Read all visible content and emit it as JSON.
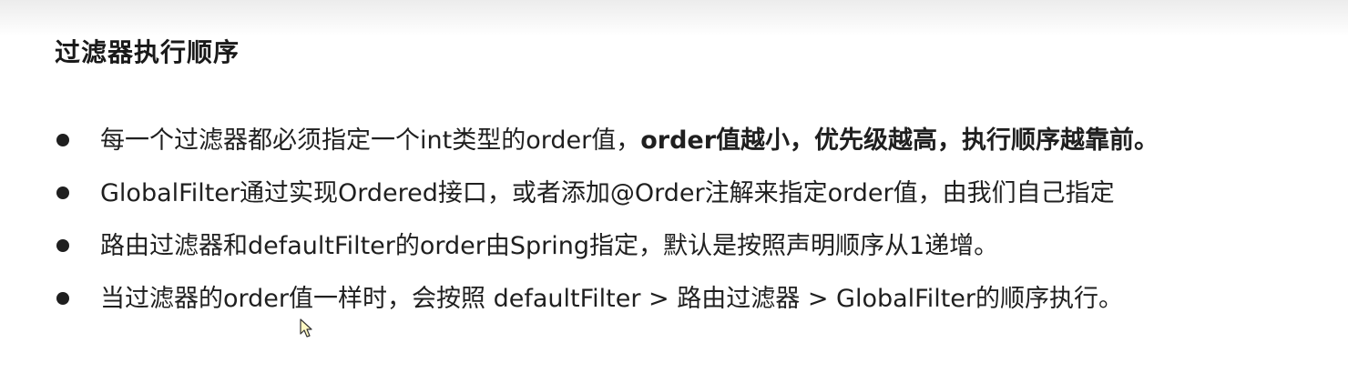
{
  "slide": {
    "title": "过滤器执行顺序",
    "bullets": [
      {
        "text": "每一个过滤器都必须指定一个int类型的order值，",
        "emphasis": "order值越小，优先级越高，执行顺序越靠前。"
      },
      {
        "text": "GlobalFilter通过实现Ordered接口，或者添加@Order注解来指定order值，由我们自己指定"
      },
      {
        "text": "路由过滤器和defaultFilter的order由Spring指定，默认是按照声明顺序从1递增。"
      },
      {
        "text": "当过滤器的order值一样时，会按照 defaultFilter > 路由过滤器 > GlobalFilter的顺序执行。"
      }
    ]
  },
  "icons": {
    "bullet": "filled-circle",
    "cursor": "mouse-pointer-icon"
  },
  "colors": {
    "text": "#1f1f1f",
    "background": "#ffffff",
    "cursor_fill": "#fff9c4"
  }
}
